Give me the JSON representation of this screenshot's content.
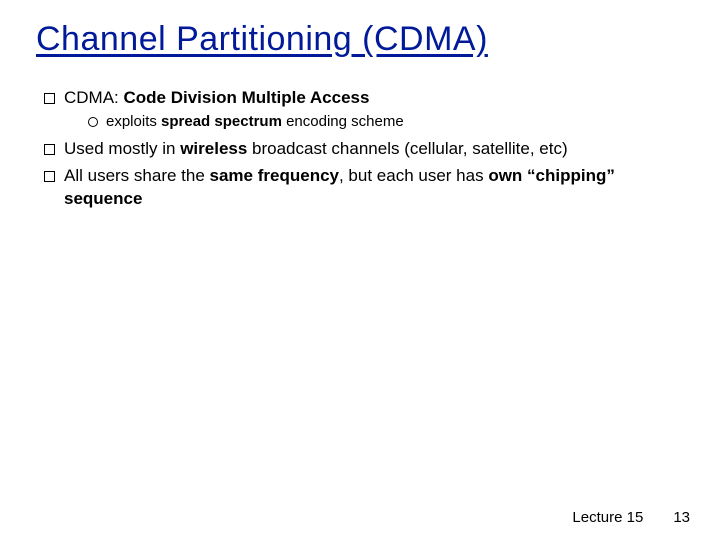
{
  "title": "Channel Partitioning (CDMA)",
  "bullets": {
    "b1_pre": "CDMA: ",
    "b1_bold": "Code Division Multiple Access",
    "b1_sub_pre": "exploits ",
    "b1_sub_bold": "spread spectrum",
    "b1_sub_post": " encoding scheme",
    "b2_pre": "Used mostly in ",
    "b2_bold": "wireless",
    "b2_post": " broadcast channels (cellular, satellite, etc)",
    "b3_a": "All users share the ",
    "b3_bold1": "same",
    "b3_b": " ",
    "b3_bold2": "frequency",
    "b3_c": ", but each user has ",
    "b3_bold3": "own “chipping” sequence"
  },
  "footer": {
    "lecture": "Lecture 15",
    "page": "13"
  }
}
